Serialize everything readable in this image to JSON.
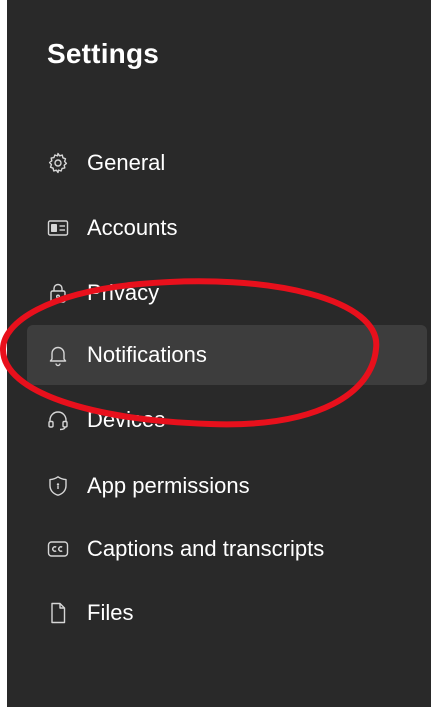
{
  "header": {
    "title": "Settings"
  },
  "nav": {
    "items": [
      {
        "label": "General",
        "icon": "gear-icon"
      },
      {
        "label": "Accounts",
        "icon": "id-card-icon"
      },
      {
        "label": "Privacy",
        "icon": "lock-icon"
      },
      {
        "label": "Notifications",
        "icon": "bell-icon",
        "selected": true
      },
      {
        "label": "Devices",
        "icon": "headset-icon"
      },
      {
        "label": "App permissions",
        "icon": "shield-icon"
      },
      {
        "label": "Captions and transcripts",
        "icon": "closed-captions-icon"
      },
      {
        "label": "Files",
        "icon": "file-icon"
      }
    ]
  },
  "colors": {
    "panel_background": "#292929",
    "selected_background": "#3d3d3d",
    "text": "#ffffff",
    "annotation": "#e8101c"
  }
}
